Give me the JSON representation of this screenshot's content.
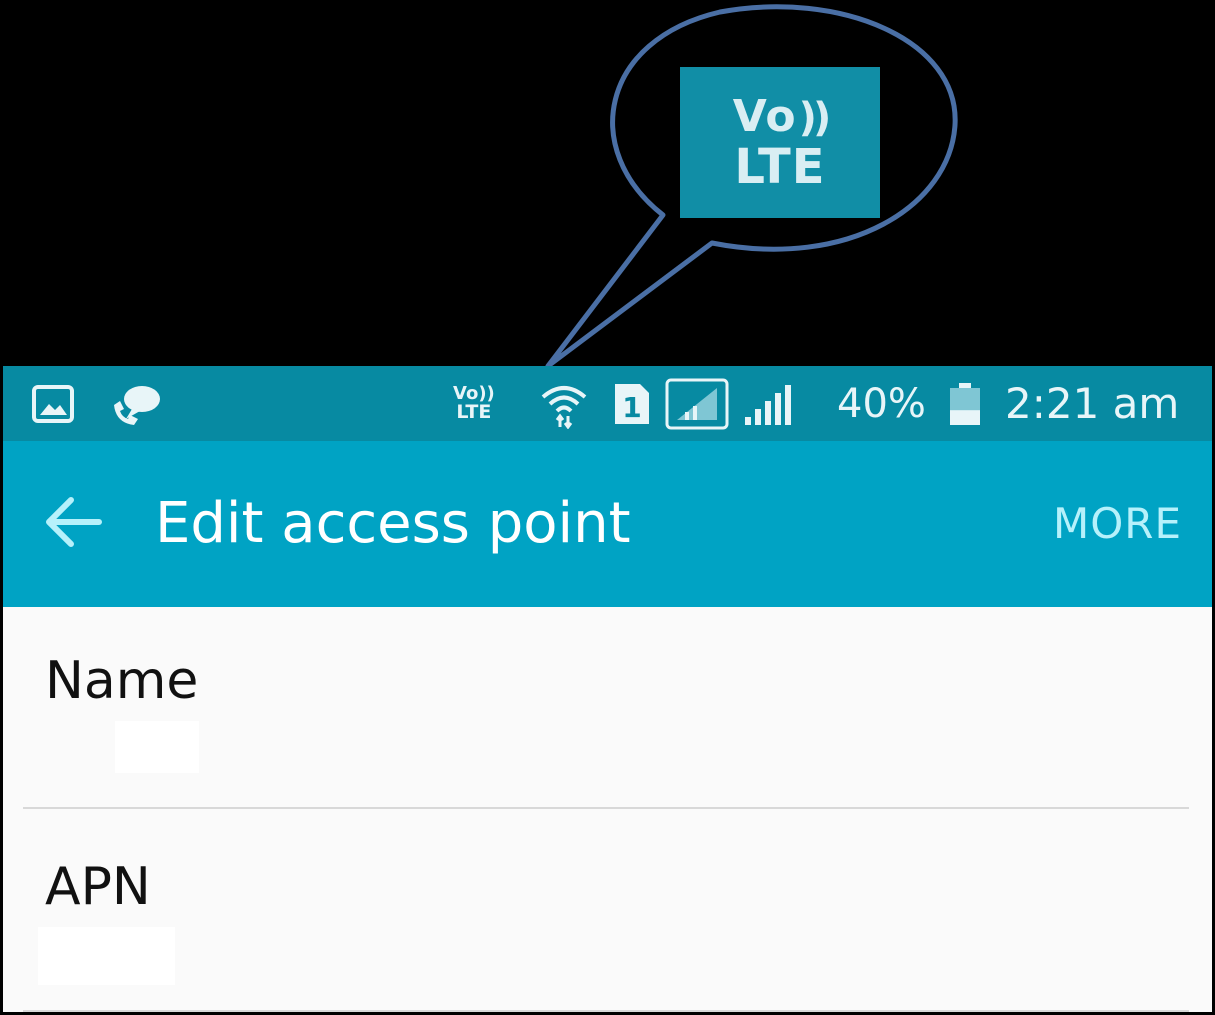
{
  "callout": {
    "vo_text": "Vo",
    "waves_text": "))",
    "lte_text": "LTE",
    "bubble_stroke": "#4a6fa5",
    "zoom_bg": "#118ea6"
  },
  "status_bar": {
    "volte_line1": "Vo))",
    "volte_line2": "LTE",
    "sim_slot": "1",
    "battery_percent": "40%",
    "battery_level": 0.4,
    "time": "2:21 am",
    "bg": "#078aa2"
  },
  "app_bar": {
    "title": "Edit access point",
    "more_label": "MORE",
    "back_icon": "arrow-left-icon",
    "bg": "#00a3c4"
  },
  "preferences": [
    {
      "label": "Name",
      "value": ""
    },
    {
      "label": "APN",
      "value": ""
    }
  ]
}
